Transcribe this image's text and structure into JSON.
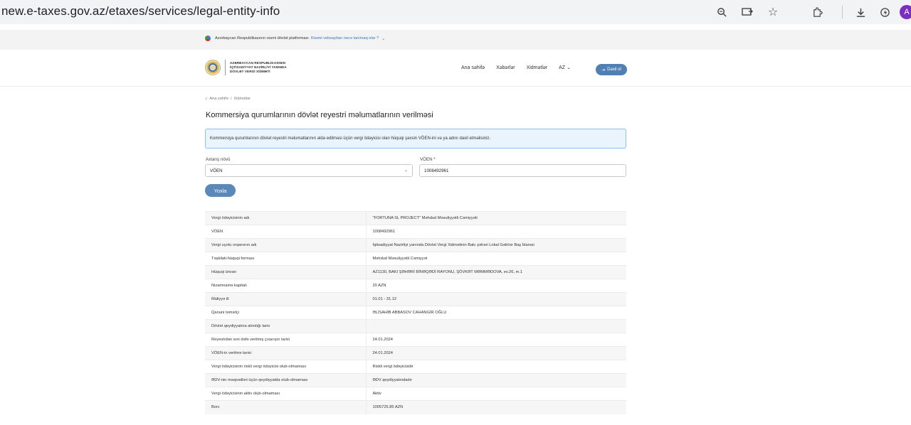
{
  "browser": {
    "url": "new.e-taxes.gov.az/etaxes/services/legal-entity-info",
    "profile_initial": "A"
  },
  "gov_banner": {
    "text": "Azərbaycan Respublikasının rəsmi dövlət platforması",
    "link": "Rəsmi vebsaytları necə tanımaq olar ?"
  },
  "header": {
    "logo_lines": [
      "AZƏRBAYCAN RESPUBLİKASININ",
      "İQTİSADİYYAT NAZİRLİYİ YANINDA",
      "DÖVLƏT VERGİ XİDMƏTİ"
    ],
    "nav": [
      "Ana səhifə",
      "Xəbərlər",
      "Xidmətlər"
    ],
    "lang": "AZ",
    "login_label": "Daxil ol"
  },
  "breadcrumb": {
    "home": "Ana səhifə",
    "separator": "/",
    "current": "Xidmətlər"
  },
  "page_title": "Kommersiya qurumlarının dövlət reyestri məlumatlarının verilməsi",
  "info_message": "Kommersiya qurumlarının dövlət reyestri məlumatlarının əldə edilməsi üçün vergi ödəyicisi olan hüquqi şəxsin VÖEN-ini və ya adını daxil etməlisiniz.",
  "form": {
    "search_type_label": "Axtarış növü",
    "search_type_value": "VÖEN",
    "voen_label": "VÖEN *",
    "voen_value": "1008492961",
    "submit_label": "Yoxla"
  },
  "results": [
    {
      "key": "Vergi ödəyicisinin adı",
      "value": "\"FORTUNA SL PROJECT\" Məhdud Məsuliyyətli Cəmiyyəti"
    },
    {
      "key": "VÖEN",
      "value": "1008492961"
    },
    {
      "key": "Vergi uçotu orqanının adı",
      "value": "İqtisadiyyat Nazirliyi yanında Dövlət Vergi Xidmətinin Bakı şəhəri Lokal Gəlirlər Baş İdarəsi"
    },
    {
      "key": "Təşkilati-hüquqi forması",
      "value": "Məhdud Məsuliyyətli Cəmiyyət"
    },
    {
      "key": "Hüquqi ünvan",
      "value": "AZ1130, BAKI ŞƏHƏRİ BİNƏQƏDİ RAYONU, ŞÖVKƏT MƏMMƏDOVA, ev.26, m.1"
    },
    {
      "key": "Nizamnamə kapitalı",
      "value": "20 AZN"
    },
    {
      "key": "Maliyyə ili",
      "value": "01.01 - 31.12"
    },
    {
      "key": "Qanuni təmsilçi",
      "value": "ƏLİSAHİB ABBASOV CAHANGİR OĞLU"
    },
    {
      "key": "Dövlət qeydiyyatına alındığı tarix",
      "value": ""
    },
    {
      "key": "Reyestrdən son dəfə verilmiş çıxarışın tarixi",
      "value": "24.01.2024"
    },
    {
      "key": "VÖEN-in verilmə tarixi",
      "value": "24.01.2024"
    },
    {
      "key": "Vergi ödəyicisinin riskli vergi ödəyicisi olub-olmaması",
      "value": "Riskli vergi ödəyicisidir"
    },
    {
      "key": "ƏDV-nin məqsədləri üçün qeydiyyatda olub-olmaması",
      "value": "ƏDV qeydiyyatındadır"
    },
    {
      "key": "Vergi ödəyicisinin aktiv olub-olmaması",
      "value": "Aktiv"
    },
    {
      "key": "Borc",
      "value": "1005725.85 AZN"
    }
  ]
}
